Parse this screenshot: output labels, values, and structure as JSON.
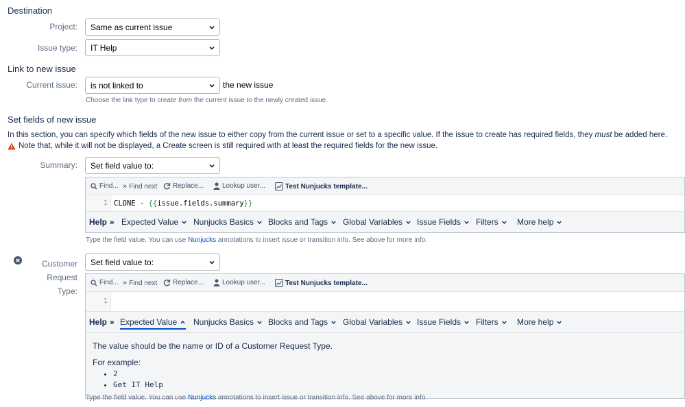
{
  "destination": {
    "heading": "Destination",
    "project_label": "Project:",
    "project_value": "Same as current issue",
    "issue_type_label": "Issue type:",
    "issue_type_value": "IT Help"
  },
  "link": {
    "heading": "Link to new issue",
    "current_issue_label": "Current issue:",
    "current_issue_value": "is not linked to",
    "suffix": "the new issue",
    "help_pre": "Choose the link type to create ",
    "help_from": "from",
    "help_mid": " the current issue ",
    "help_to": "to",
    "help_post": " the newly created issue."
  },
  "set_fields": {
    "heading": "Set fields of new issue",
    "intro_pre": "In this section, you can specify which fields of the new issue to either copy from the current issue or set to a specific value. If the issue to create has required fields, they ",
    "intro_must": "must",
    "intro_post": " be added here.",
    "warning": "Note that, while it will not be displayed, a Create screen is still required with at least the required fields for the new issue."
  },
  "toolbar": {
    "find": "Find...",
    "find_next": "Find next",
    "replace": "Replace...",
    "lookup_user": "Lookup user...",
    "test_template": "Test Nunjucks template..."
  },
  "helpbar": {
    "help": "Help",
    "expected_value": "Expected Value",
    "nunjucks_basics": "Nunjucks Basics",
    "blocks_tags": "Blocks and Tags",
    "global_vars": "Global Variables",
    "issue_fields": "Issue Fields",
    "filters": "Filters",
    "more_help": "More help"
  },
  "summary": {
    "label": "Summary:",
    "select_value": "Set field value to:",
    "line_number": "1",
    "code_text": "CLONE - ",
    "code_open": "{{",
    "code_expr": "issue.fields.summary",
    "code_close": "}}"
  },
  "field_help": {
    "pre": "Type the field value. You can use ",
    "link": "Nunjucks",
    "post": " annotations to insert issue or transition info. See above for more info."
  },
  "customer_request": {
    "label_line1": "Customer",
    "label_line2": "Request",
    "label_line3": "Type:",
    "select_value": "Set field value to:",
    "line_number": "1",
    "doc_text": "The value should be the name or ID of a Customer Request Type.",
    "doc_example": "For example:",
    "examples": [
      "2",
      "Get IT Help"
    ]
  }
}
